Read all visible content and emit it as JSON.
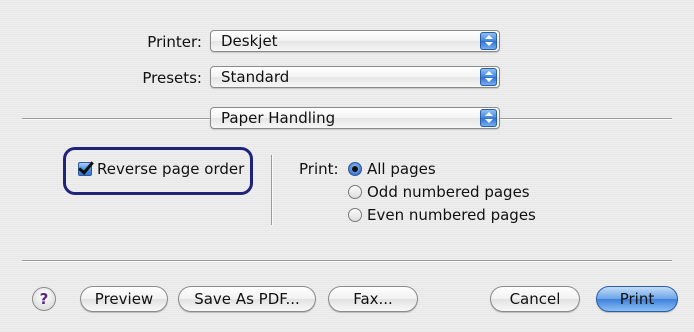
{
  "printer": {
    "label": "Printer:",
    "value": "Deskjet"
  },
  "presets": {
    "label": "Presets:",
    "value": "Standard"
  },
  "panel": {
    "value": "Paper Handling"
  },
  "reverse_page_order": {
    "label": "Reverse page order",
    "checked": true
  },
  "print_range": {
    "label": "Print:",
    "options": [
      {
        "label": "All pages",
        "selected": true
      },
      {
        "label": "Odd numbered pages",
        "selected": false
      },
      {
        "label": "Even numbered pages",
        "selected": false
      }
    ]
  },
  "buttons": {
    "help": "?",
    "preview": "Preview",
    "save_pdf": "Save As PDF...",
    "fax": "Fax...",
    "cancel": "Cancel",
    "print": "Print"
  },
  "colors": {
    "highlight_ring": "#20237a",
    "aqua_blue": "#3e80dc"
  }
}
